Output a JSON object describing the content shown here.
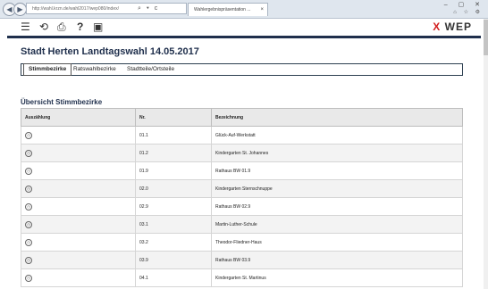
{
  "browser": {
    "url": "http://wahl.krzn.de/wahl2017/wep080/index/",
    "tab_title": "Wahlergebnispräsentation ...",
    "tab_close": "×",
    "back": "◀",
    "forward": "▶",
    "addr_icons": "⌕ ▾ c",
    "window_buttons": "–  ▢  ✕",
    "window_icons": "⌂ ☆ ⚙"
  },
  "toolbar": {
    "menu_icon": "☰",
    "refresh_icon": "⟲",
    "print_icon": "⎙",
    "help_icon": "?",
    "display_icon": "▣",
    "logo_mark": "X",
    "logo_text": "WEP"
  },
  "page": {
    "title": "Stadt Herten Landtagswahl 14.05.2017",
    "tabs": [
      "Stimmbezirke",
      "Ratswahlbezirke",
      "Stadtteile/Ortsteile"
    ],
    "subtitle": "Übersicht Stimmbezirke"
  },
  "table": {
    "headers": [
      "Auszählung",
      "Nr.",
      "Bezeichnung"
    ],
    "rows": [
      {
        "nr": "01.1",
        "name": "Glück-Auf-Werkstatt"
      },
      {
        "nr": "01.2",
        "name": "Kindergarten St. Johannes"
      },
      {
        "nr": "01.9",
        "name": "Rathaus BW 01.9"
      },
      {
        "nr": "02.0",
        "name": "Kindergarten Sternschnuppe"
      },
      {
        "nr": "02.9",
        "name": "Rathaus BW 02.9"
      },
      {
        "nr": "03.1",
        "name": "Martin-Luther-Schule"
      },
      {
        "nr": "03.2",
        "name": "Theodor-Fliedner-Haus"
      },
      {
        "nr": "03.9",
        "name": "Rathaus BW 03.9"
      },
      {
        "nr": "04.1",
        "name": "Kindergarten St. Martinus"
      }
    ]
  },
  "colors": {
    "accent": "#1f2f4c",
    "logo_red": "#d21f1f"
  }
}
